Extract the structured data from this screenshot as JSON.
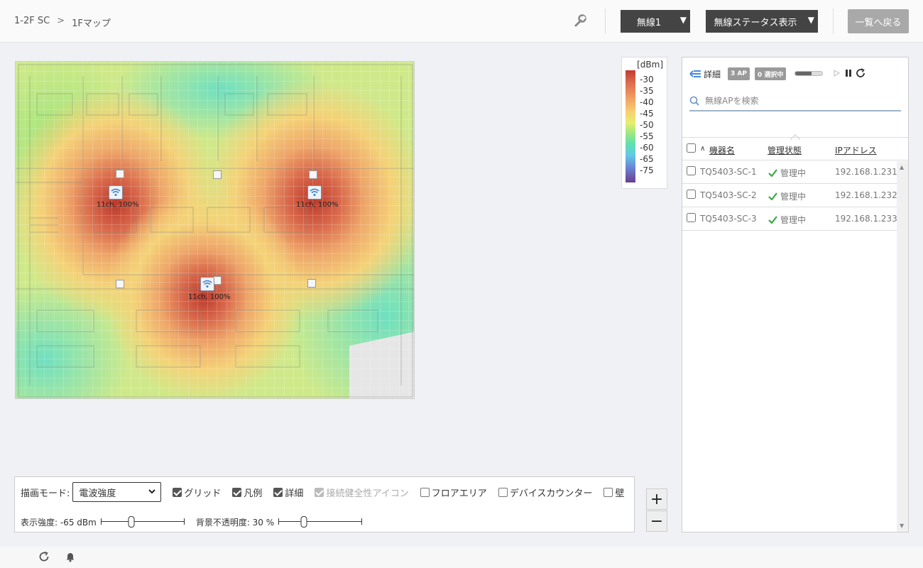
{
  "header": {
    "breadcrumb": [
      "1-2F SC",
      "1Fマップ"
    ],
    "breadcrumb_sep": ">",
    "wireless_select": "無線1",
    "status_select": "無線ステータス表示",
    "back_label": "一覧へ戻る"
  },
  "map": {
    "aps": [
      {
        "label": "11ch, 100%"
      },
      {
        "label": "11ch, 100%"
      },
      {
        "label": "11ch, 100%"
      }
    ]
  },
  "legend": {
    "unit": "[dBm]",
    "ticks": [
      "-30",
      "-35",
      "-40",
      "-45",
      "-50",
      "-55",
      "-60",
      "-65",
      "-75"
    ]
  },
  "panel": {
    "detail_label": "詳細",
    "ap_badge": "3 AP",
    "selected_badge": "0 選択中",
    "progress": 0.6,
    "search_placeholder": "無線APを検索",
    "columns": {
      "sort_indicator": "∧",
      "name": "機器名",
      "status": "管理状態",
      "ip": "IPアドレス"
    },
    "rows": [
      {
        "name": "TQ5403-SC-1",
        "status": "管理中",
        "ip": "192.168.1.231"
      },
      {
        "name": "TQ5403-SC-2",
        "status": "管理中",
        "ip": "192.168.1.232"
      },
      {
        "name": "TQ5403-SC-3",
        "status": "管理中",
        "ip": "192.168.1.233"
      }
    ]
  },
  "controls": {
    "mode_label": "描画モード:",
    "mode_value": "電波強度",
    "checks": {
      "grid": "グリッド",
      "legend": "凡例",
      "detail": "詳細",
      "health": "接続健全性アイコン",
      "floor": "フロアエリア",
      "counter": "デバイスカウンター",
      "wall": "壁"
    },
    "strength_label": "表示強度: -65 dBm",
    "strength_level": 0.37,
    "opacity_label": "背景不透明度: 30 %",
    "opacity_level": 0.3,
    "zoom_in": "+",
    "zoom_out": "−"
  },
  "colors": {
    "accent": "#444444",
    "ok_green": "#3aa845",
    "link_blue": "#2f7fd6"
  }
}
